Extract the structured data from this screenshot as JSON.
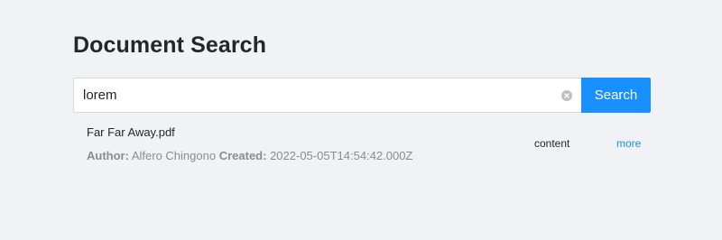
{
  "page": {
    "title": "Document Search"
  },
  "search": {
    "value": "lorem",
    "button_label": "Search",
    "clear_icon": "close-circle-icon"
  },
  "results": [
    {
      "title": "Far Far Away.pdf",
      "author_label": "Author:",
      "author": "Alfero Chingono",
      "created_label": "Created:",
      "created": "2022-05-05T14:54:42.000Z",
      "content_label": "content",
      "more_label": "more"
    }
  ],
  "colors": {
    "accent": "#1890ff",
    "background": "#f0f2f5",
    "muted_text": "#8c8c8c"
  }
}
